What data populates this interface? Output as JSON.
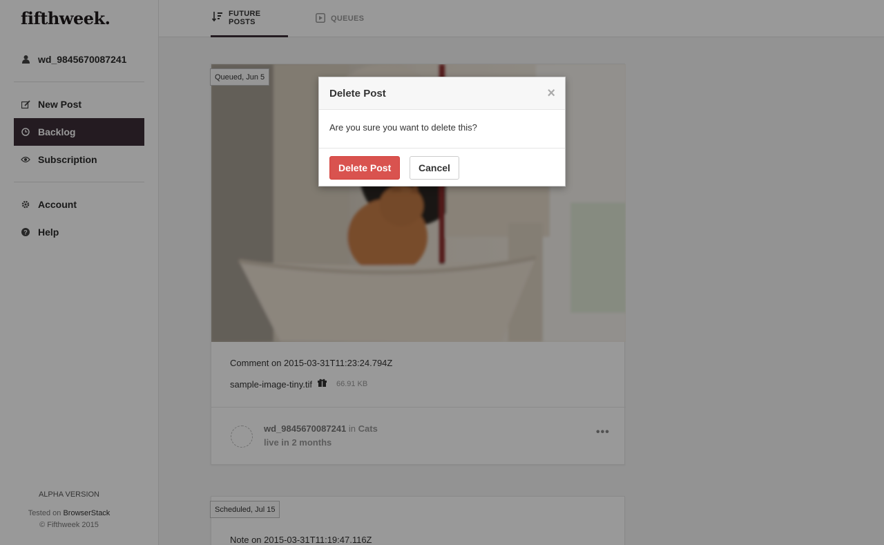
{
  "app": {
    "logo": "fifthweek."
  },
  "sidebar": {
    "user": {
      "label": "wd_9845670087241",
      "icon": "user-icon"
    },
    "items": [
      {
        "label": "New Post",
        "icon": "edit-icon"
      },
      {
        "label": "Backlog",
        "icon": "clock-icon",
        "active": true
      },
      {
        "label": "Subscription",
        "icon": "eye-icon"
      },
      {
        "label": "Account",
        "icon": "gear-icon"
      },
      {
        "label": "Help",
        "icon": "help-icon"
      }
    ],
    "footer": {
      "version": "ALPHA VERSION",
      "tested_prefix": "Tested on ",
      "tested_link": "BrowserStack",
      "copyright": "© Fifthweek 2015"
    }
  },
  "tabs": [
    {
      "label": "FUTURE POSTS",
      "icon": "sort-icon",
      "active": true
    },
    {
      "label": "QUEUES",
      "icon": "play-icon",
      "active": false
    }
  ],
  "posts": [
    {
      "badge": "Queued, Jun 5",
      "comment": "Comment on 2015-03-31T11:23:24.794Z",
      "file_name": "sample-image-tiny.tif",
      "file_size": "66.91 KB",
      "author": "wd_9845670087241",
      "in_word": " in ",
      "channel": "Cats",
      "live": "live in 2 months"
    },
    {
      "badge": "Scheduled, Jul 15",
      "comment": "Note on 2015-03-31T11:19:47.116Z"
    }
  ],
  "modal": {
    "title": "Delete Post",
    "close": "×",
    "message": "Are you sure you want to delete this?",
    "confirm_label": "Delete Post",
    "cancel_label": "Cancel"
  },
  "colors": {
    "nav_active": "#3c2e38",
    "danger": "#d9534f",
    "overlay": "rgba(0,0,0,0.4)"
  }
}
